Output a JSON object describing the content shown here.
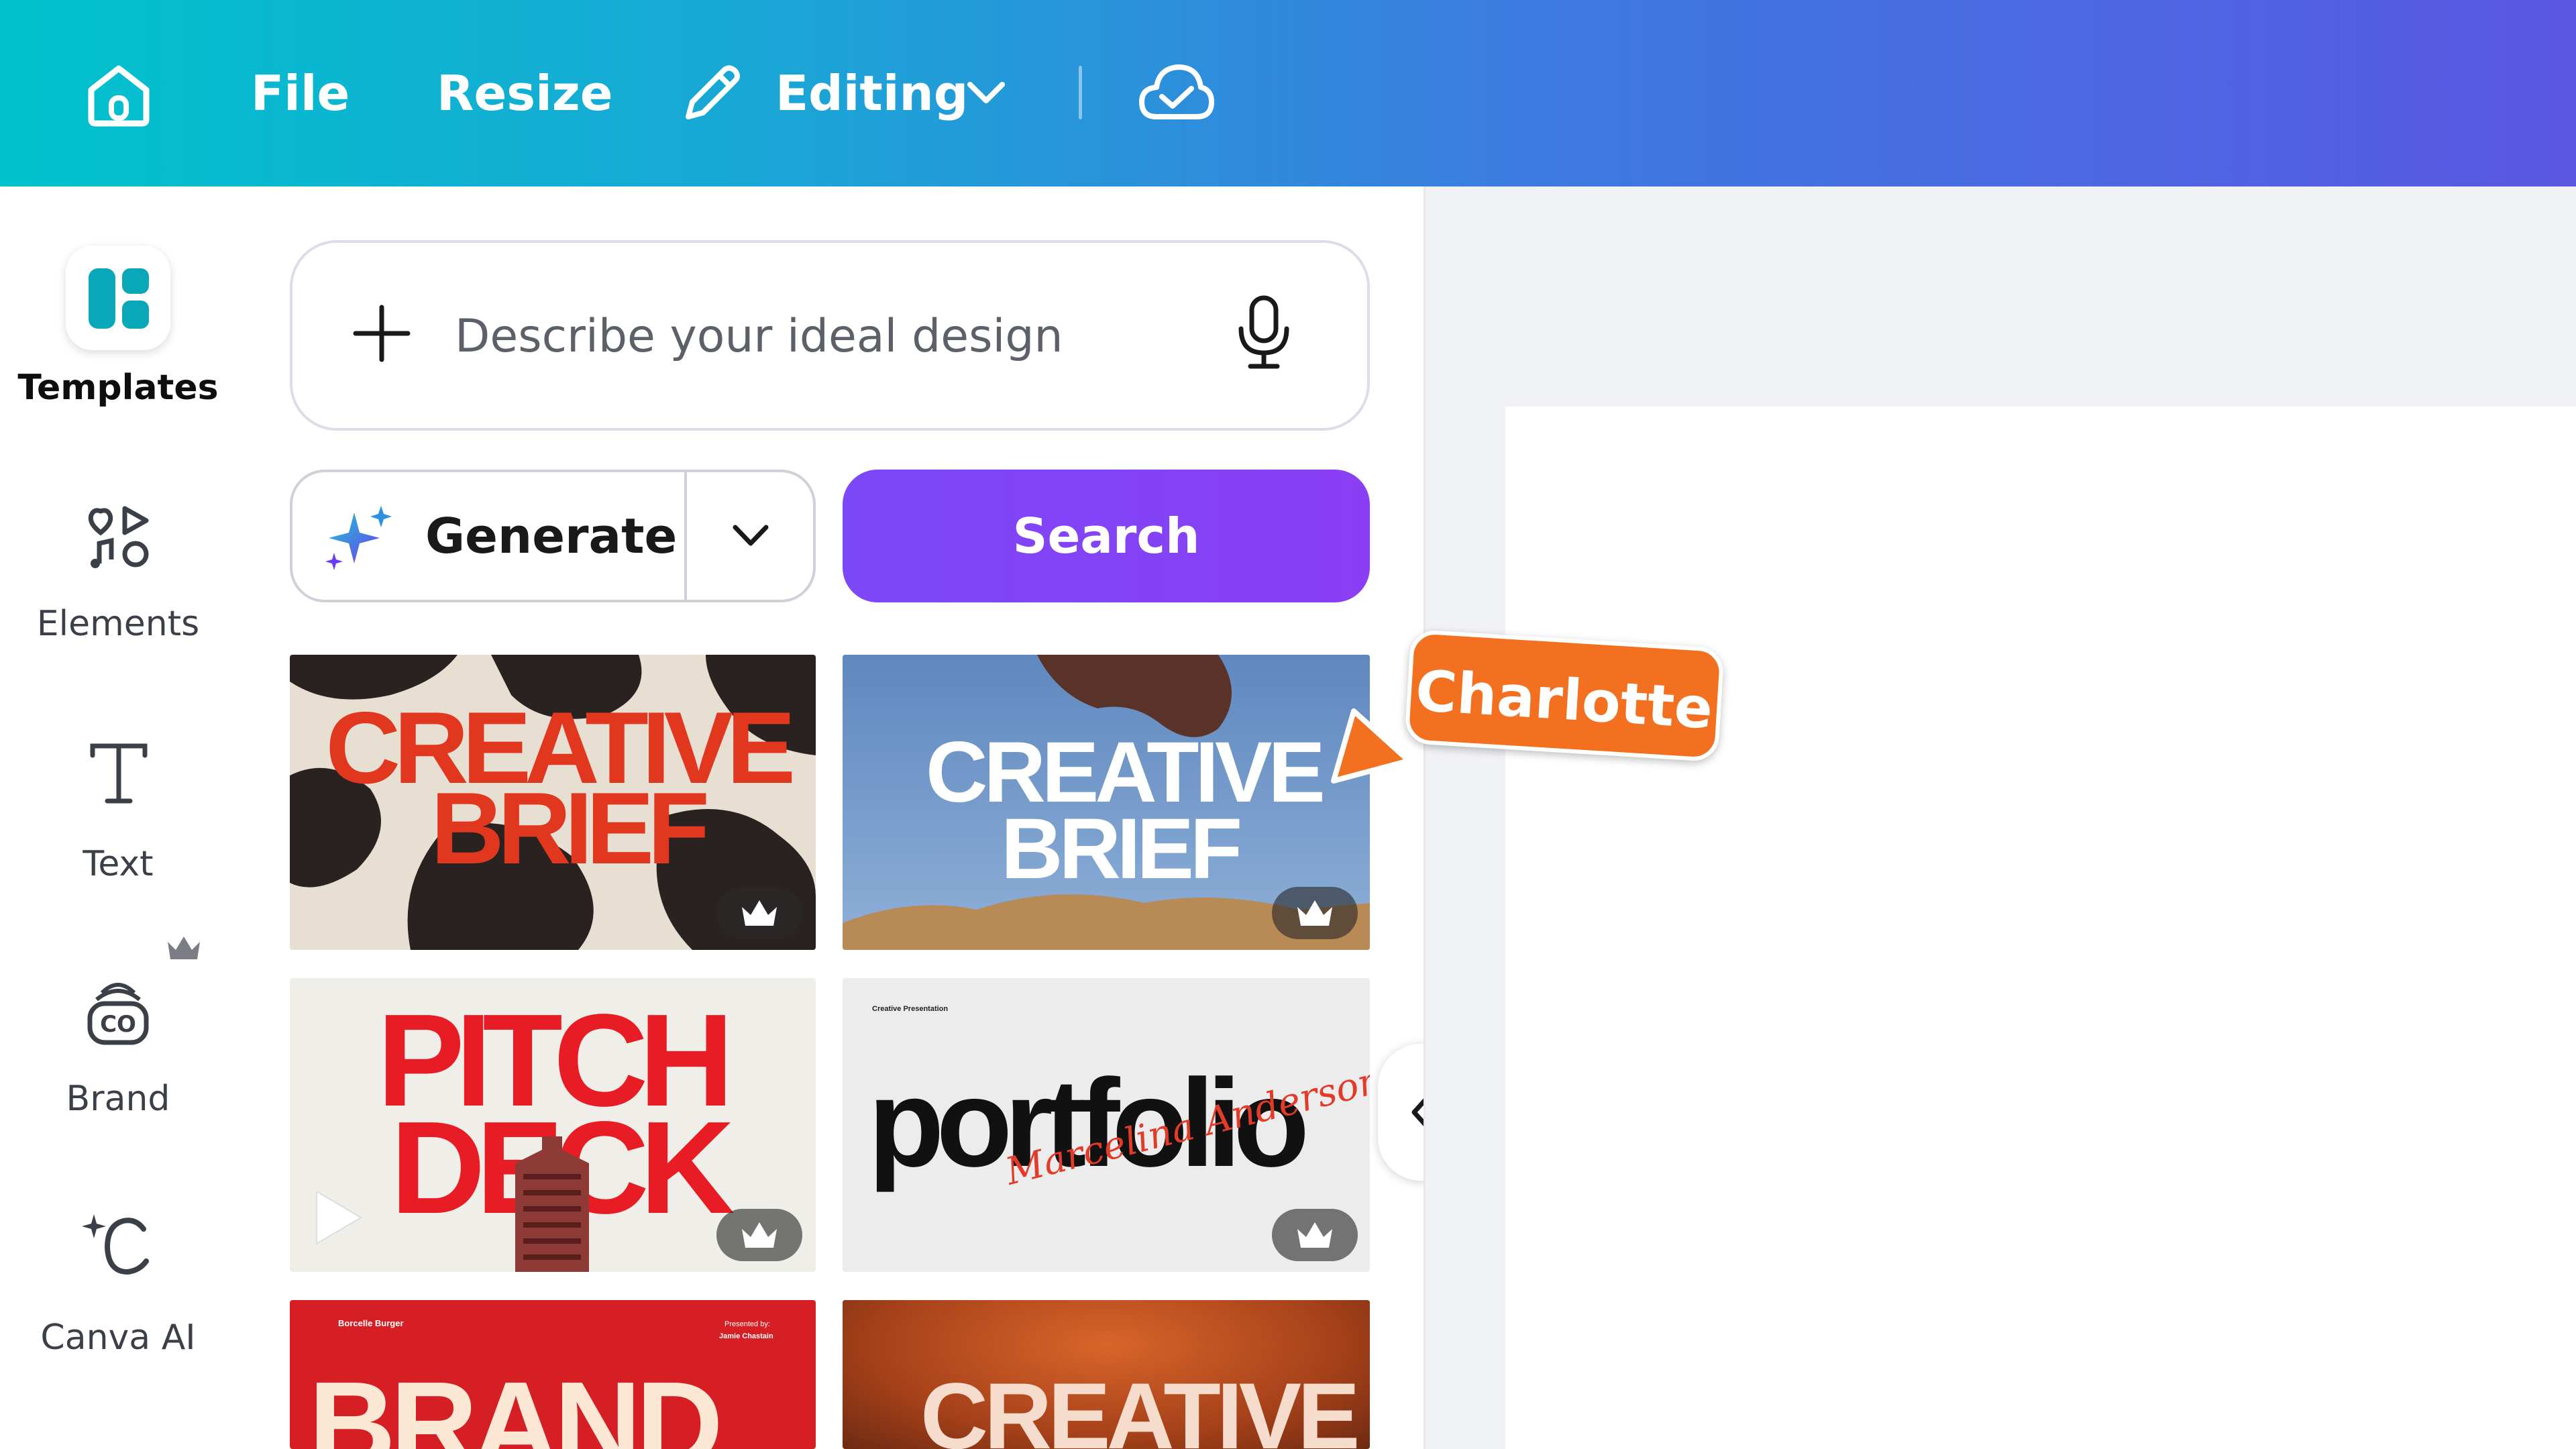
{
  "topbar": {
    "file_label": "File",
    "resize_label": "Resize",
    "editing_label": "Editing",
    "icons": [
      "home-icon",
      "pencil-icon",
      "chevron-down-icon",
      "cloud-check-icon"
    ]
  },
  "nav": {
    "items": [
      {
        "label": "Templates",
        "icon": "templates-icon",
        "active": true
      },
      {
        "label": "Elements",
        "icon": "elements-icon"
      },
      {
        "label": "Text",
        "icon": "text-icon"
      },
      {
        "label": "Brand",
        "icon": "brand-icon",
        "premium": true
      },
      {
        "label": "Canva AI",
        "icon": "canva-ai-icon"
      }
    ]
  },
  "panel": {
    "search_placeholder": "Describe your ideal design",
    "generate_label": "Generate",
    "search_button": "Search",
    "accent_color": "#7d2ae8"
  },
  "templates": [
    {
      "title_line1": "CREATIVE",
      "title_line2": "BRIEF",
      "premium": true
    },
    {
      "title_line1": "CREATIVE",
      "title_line2": "BRIEF",
      "premium": true
    },
    {
      "title_line1": "PITCH",
      "title_line2": "DECK",
      "premium": true
    },
    {
      "title": "portfolio",
      "small_heading": "Creative Presentation",
      "signature": "Marcelina Anderson",
      "premium": true
    },
    {
      "title": "BRAND",
      "small_top_left": "Borcelle Burger",
      "small_top_right_1": "Presented by:",
      "small_top_right_2": "Jamie Chastain"
    },
    {
      "title": "CREATIVE"
    }
  ],
  "collaborator": {
    "name": "Charlotte",
    "color": "#f2701f"
  }
}
